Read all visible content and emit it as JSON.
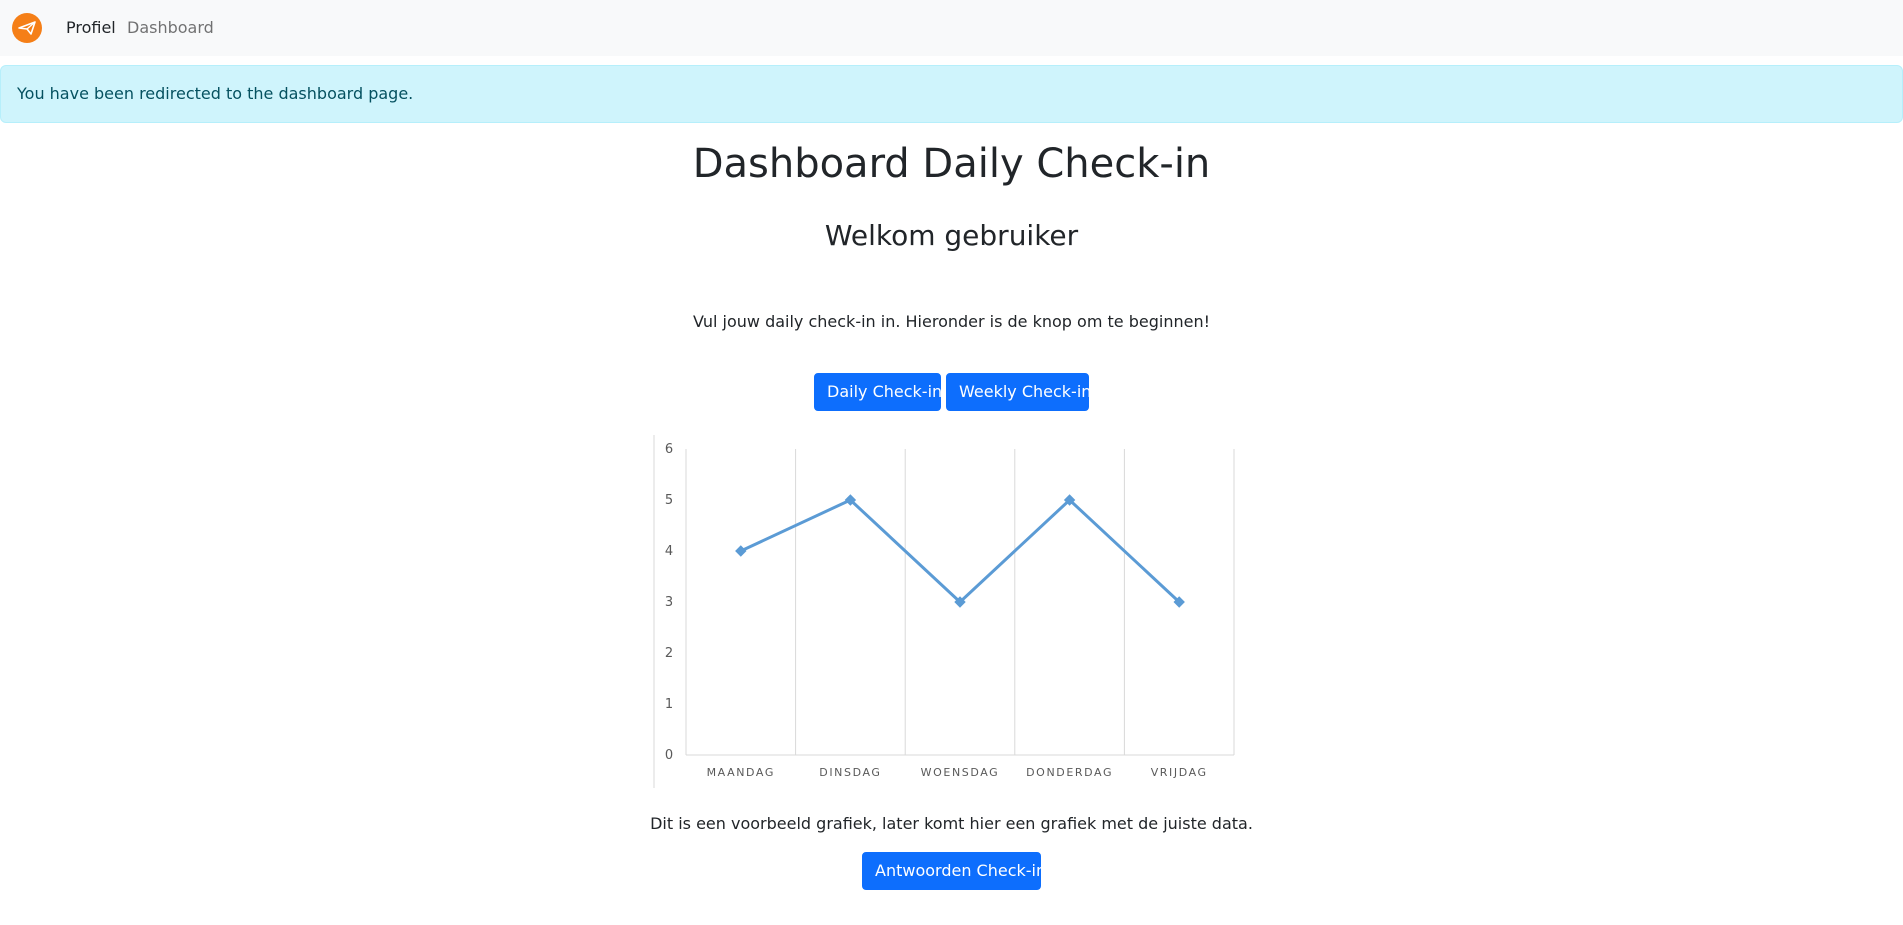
{
  "navbar": {
    "logo_icon": "paper-plane-icon",
    "brand_color": "#f57f17",
    "links": [
      {
        "label": "Profiel"
      },
      {
        "label": "Dashboard"
      }
    ]
  },
  "alert": {
    "message": "You have been redirected to the dashboard page.",
    "background": "#cff4fc",
    "text_color": "#055160"
  },
  "main": {
    "title": "Dashboard Daily Check-in",
    "subtitle": "Welkom gebruiker",
    "intro": "Vul jouw daily check-in in. Hieronder is de knop om te beginnen!",
    "buttons": {
      "daily": "Daily Check-in",
      "weekly": "Weekly Check-in"
    },
    "caption": "Dit is een voorbeeld grafiek, later komt hier een grafiek met de juiste data.",
    "answers_button": "Antwoorden Check-in",
    "accent_color": "#0d6efd"
  },
  "chart_data": {
    "type": "line",
    "categories": [
      "MAANDAG",
      "DINSDAG",
      "WOENSDAG",
      "DONDERDAG",
      "VRIJDAG"
    ],
    "values": [
      4,
      5,
      3,
      5,
      3
    ],
    "yticks": [
      0,
      1,
      2,
      3,
      4,
      5,
      6
    ],
    "ylim": [
      0,
      6
    ],
    "grid": "vertical",
    "legend": "none",
    "line_color": "#5b9bd5"
  }
}
